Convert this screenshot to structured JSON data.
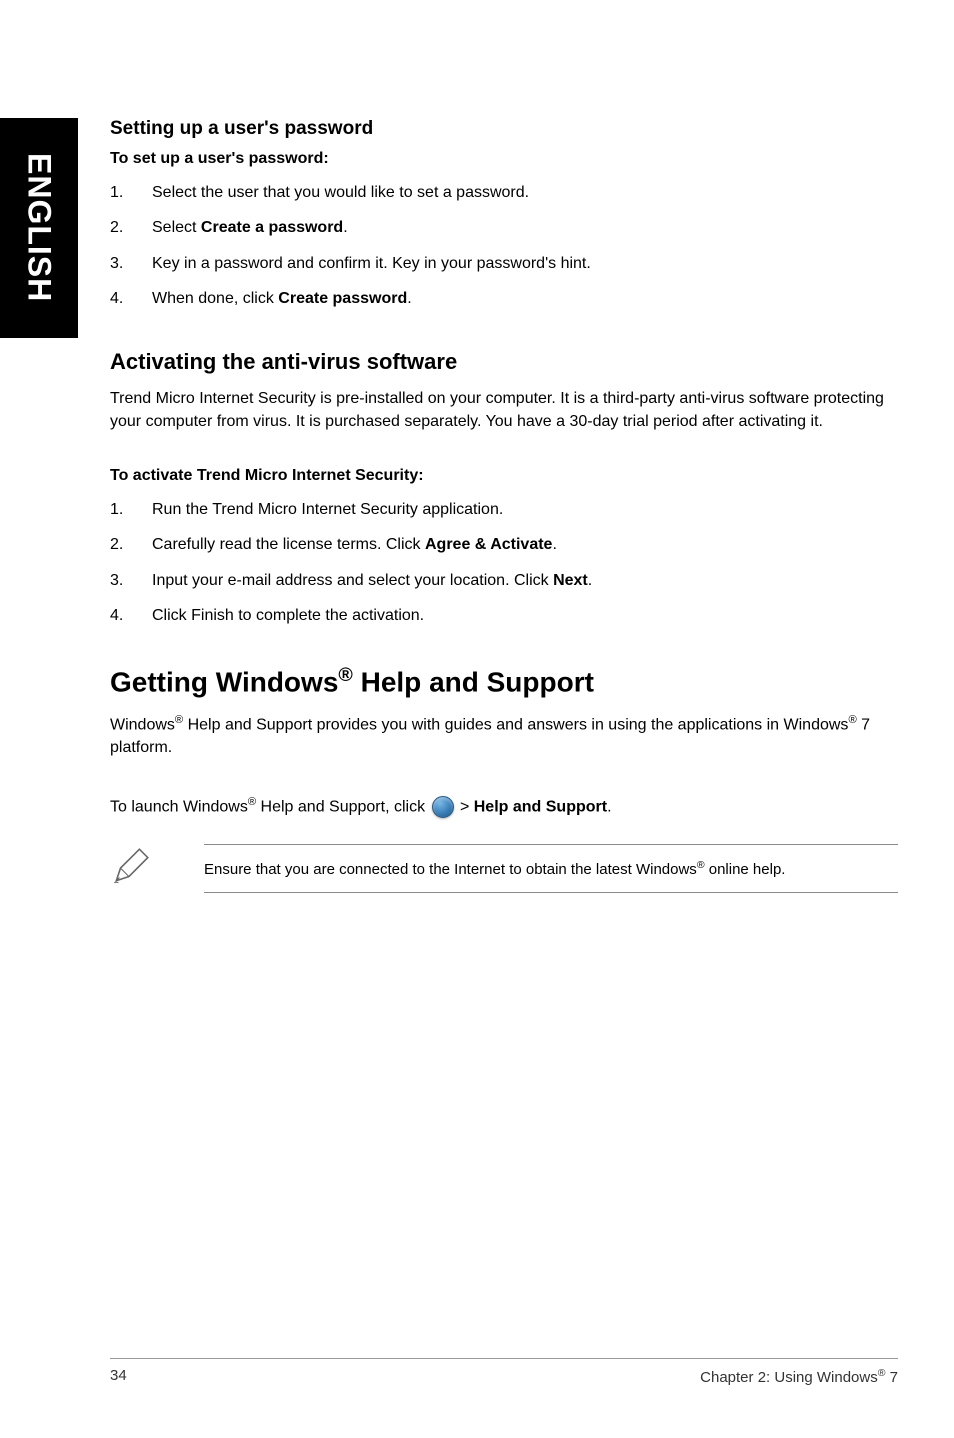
{
  "sidebar": {
    "language_label": "ENGLISH"
  },
  "section1": {
    "heading": "Setting up a user's password",
    "instruction_heading": "To set up a user's password:",
    "steps": [
      {
        "num": "1.",
        "text_before": "Select the user that you would like to set a password.",
        "bold": "",
        "text_after": ""
      },
      {
        "num": "2.",
        "text_before": "Select ",
        "bold": "Create a password",
        "text_after": "."
      },
      {
        "num": "3.",
        "text_before": "Key in a password and confirm it. Key in your password's hint.",
        "bold": "",
        "text_after": ""
      },
      {
        "num": "4.",
        "text_before": "When done, click ",
        "bold": "Create password",
        "text_after": "."
      }
    ]
  },
  "section2": {
    "heading": "Activating the anti-virus software",
    "intro": "Trend Micro Internet Security is pre-installed on your computer. It is a third-party anti-virus software protecting your computer from virus. It is purchased separately. You have a 30-day trial period after activating it.",
    "instruction_heading": "To activate Trend Micro Internet Security:",
    "steps": [
      {
        "num": "1.",
        "text_before": "Run the Trend Micro Internet Security application.",
        "bold": "",
        "text_after": ""
      },
      {
        "num": "2.",
        "text_before": "Carefully read the license terms. Click ",
        "bold": "Agree & Activate",
        "text_after": "."
      },
      {
        "num": "3.",
        "text_before": "Input your e-mail address and select your location. Click ",
        "bold": "Next",
        "text_after": "."
      },
      {
        "num": "4.",
        "text_before": "Click Finish to complete the activation.",
        "bold": "",
        "text_after": ""
      }
    ]
  },
  "section3": {
    "heading_prefix": "Getting Windows",
    "heading_sup": "®",
    "heading_suffix": " Help and Support",
    "intro_1a": "Windows",
    "intro_1b": " Help and Support provides you with guides and answers in using the applications in Windows",
    "intro_1c": " 7 platform.",
    "launch_a": "To launch Windows",
    "launch_b": " Help and Support, click ",
    "launch_bold": "Help and Support",
    "launch_end": ".",
    "note_a": "Ensure that you are connected to the Internet to obtain the latest Windows",
    "note_b": " online help."
  },
  "footer": {
    "page_number": "34",
    "chapter_a": "Chapter 2: Using Windows",
    "chapter_sup": "®",
    "chapter_b": " 7"
  },
  "icons": {
    "start_orb": "windows-start-icon",
    "pencil": "pencil-note-icon"
  }
}
